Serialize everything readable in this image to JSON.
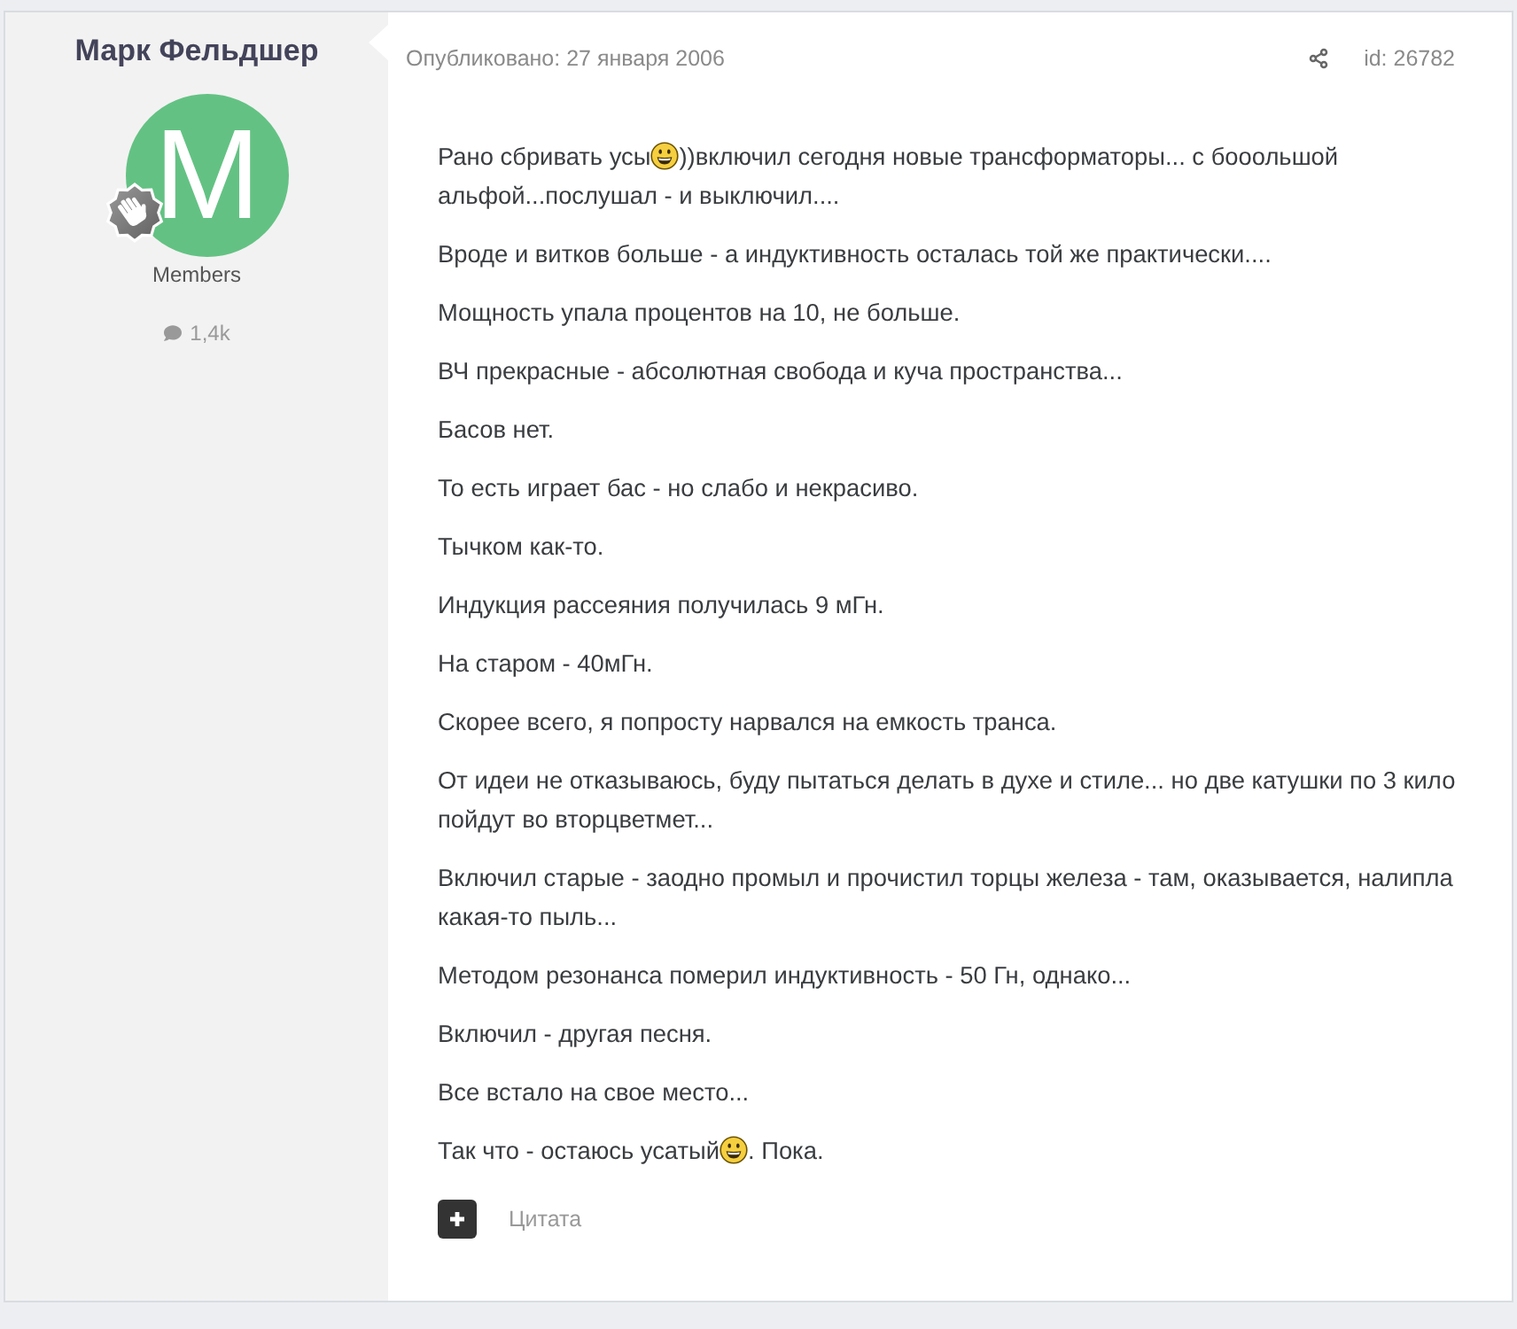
{
  "author": {
    "name": "Марк Фельдшер",
    "avatar_letter": "M",
    "group": "Members",
    "post_count": "1,4k"
  },
  "post": {
    "published": "Опубликовано: 27 января 2006",
    "id": "id: 26782",
    "paragraphs": [
      {
        "parts": [
          {
            "kind": "text",
            "text": "Рано сбривать усы"
          },
          {
            "kind": "smiley"
          },
          {
            "kind": "text",
            "text": "))включил сегодня новые трансформаторы... с бооольшой альфой...послушал - и выключил...."
          }
        ]
      },
      {
        "parts": [
          {
            "kind": "text",
            "text": "Вроде и витков больше - а индуктивность осталась той же практически...."
          }
        ]
      },
      {
        "parts": [
          {
            "kind": "text",
            "text": "Мощность упала процентов на 10, не больше."
          }
        ]
      },
      {
        "parts": [
          {
            "kind": "text",
            "text": "ВЧ прекрасные - абсолютная свобода и куча пространства..."
          }
        ]
      },
      {
        "parts": [
          {
            "kind": "text",
            "text": "Басов нет."
          }
        ]
      },
      {
        "parts": [
          {
            "kind": "text",
            "text": "То есть играет бас - но слабо и некрасиво."
          }
        ]
      },
      {
        "parts": [
          {
            "kind": "text",
            "text": "Тычком как-то."
          }
        ]
      },
      {
        "parts": [
          {
            "kind": "text",
            "text": "Индукция рассеяния получилась 9 мГн."
          }
        ]
      },
      {
        "parts": [
          {
            "kind": "text",
            "text": "На старом - 40мГн."
          }
        ]
      },
      {
        "parts": [
          {
            "kind": "text",
            "text": "Скорее всего, я попросту нарвался на емкость транса."
          }
        ]
      },
      {
        "parts": [
          {
            "kind": "text",
            "text": "От идеи не отказываюсь, буду пытаться делать в духе и стиле... но две катушки по 3 кило пойдут во вторцветмет..."
          }
        ]
      },
      {
        "parts": [
          {
            "kind": "text",
            "text": "Включил старые - заодно промыл и прочистил торцы железа - там, оказывается, налипла какая-то пыль..."
          }
        ]
      },
      {
        "parts": [
          {
            "kind": "text",
            "text": "Методом резонанса померил индуктивность - 50 Гн, однако..."
          }
        ]
      },
      {
        "parts": [
          {
            "kind": "text",
            "text": "Включил - другая песня."
          }
        ]
      },
      {
        "parts": [
          {
            "kind": "text",
            "text": "Все встало на свое место..."
          }
        ]
      },
      {
        "parts": [
          {
            "kind": "text",
            "text": "Так что - остаюсь усатый"
          },
          {
            "kind": "smiley"
          },
          {
            "kind": "text",
            "text": ". Пока."
          }
        ]
      }
    ],
    "quote_label": "Цитата"
  }
}
